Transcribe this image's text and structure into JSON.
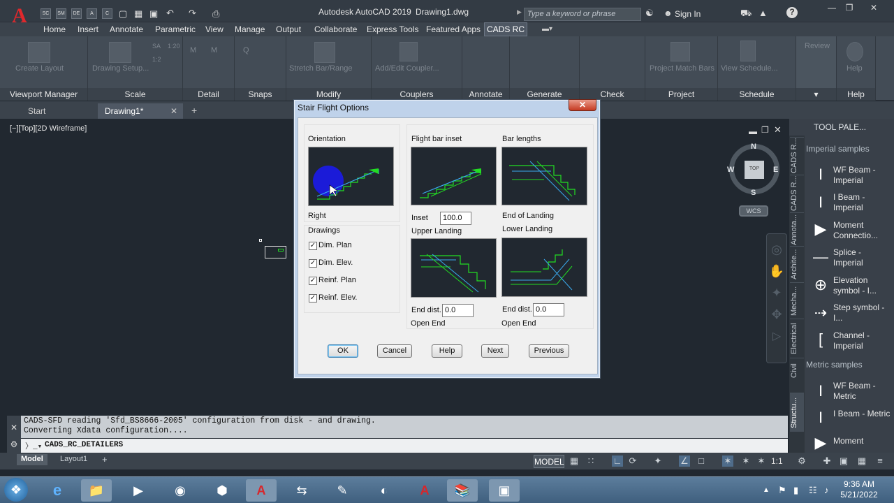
{
  "app": {
    "title": "Autodesk AutoCAD 2019",
    "file": "Drawing1.dwg",
    "logo": "A"
  },
  "quick_access": [
    "SC",
    "SM",
    "DE",
    "A",
    "C"
  ],
  "search": {
    "placeholder": "Type a keyword or phrase"
  },
  "signin": "Sign In",
  "ribbon_tabs": [
    "Home",
    "Insert",
    "Annotate",
    "Parametric",
    "View",
    "Manage",
    "Output",
    "Collaborate",
    "Express Tools",
    "Featured Apps"
  ],
  "ribbon_active_tab": "CADS RC",
  "ribbon": {
    "buttons": {
      "create_layout": "Create Layout",
      "drawing_setup": "Drawing Setup...",
      "stretch_bar": "Stretch Bar/Range",
      "add_coupler": "Add/Edit Coupler...",
      "project_match": "Project Match Bars",
      "view_schedule": "View Schedule...",
      "review": "Review",
      "help": "Help"
    },
    "groups": [
      "Viewport Manager",
      "Scale",
      "Detail",
      "Snaps",
      "Modify",
      "Couplers",
      "Annotate",
      "Generate",
      "Check",
      "Project",
      "Schedule",
      "",
      "Help"
    ],
    "small": {
      "sa": "SA",
      "scale120": "1:20",
      "scale12": "1:2",
      "m1": "M",
      "m2": "M",
      "q": "Q"
    }
  },
  "doc_tabs": {
    "start": "Start",
    "drawing": "Drawing1*",
    "add": "+"
  },
  "viewport": {
    "label": "[−][Top][2D Wireframe]"
  },
  "viewcube": {
    "n": "N",
    "s": "S",
    "e": "E",
    "w": "W",
    "top": "TOP",
    "wcs": "WCS"
  },
  "palette": {
    "title": "TOOL PALE...",
    "side_tabs": [
      "CADS R...",
      "CADS R...",
      "Annota...",
      "Archite...",
      "Mecha...",
      "Electrical",
      "Civil",
      "Structu..."
    ],
    "imperial_header": "Imperial samples",
    "metric_header": "Metric samples",
    "items": [
      {
        "label": "WF Beam - Imperial",
        "icon": "I"
      },
      {
        "label": "I Beam - Imperial",
        "icon": "I"
      },
      {
        "label": "Moment Connectio...",
        "icon": "▶"
      },
      {
        "label": "Splice - Imperial",
        "icon": "—"
      },
      {
        "label": "Elevation symbol - I...",
        "icon": "⊕"
      },
      {
        "label": "Step symbol - I...",
        "icon": "⇢"
      },
      {
        "label": "Channel - Imperial",
        "icon": "["
      },
      {
        "label": "WF Beam - Metric",
        "icon": "I"
      },
      {
        "label": "I Beam - Metric",
        "icon": "I"
      },
      {
        "label": "Moment",
        "icon": "▶"
      }
    ]
  },
  "command": {
    "history": [
      "CADS-SFD reading 'Sfd_BS8666-2005' configuration from disk - and drawing.",
      "Converting Xdata configuration...."
    ],
    "current": "CADS_RC_DETAILERS"
  },
  "layout_tabs": {
    "model": "Model",
    "layout1": "Layout1",
    "add": "+"
  },
  "status": {
    "model_btn": "MODEL",
    "scale": "1:1"
  },
  "clock": {
    "time": "9:36 AM",
    "date": "5/21/2022"
  },
  "dialog": {
    "title": "Stair Flight Options",
    "close": "✕",
    "orientation_label": "Orientation",
    "orientation_value": "Right",
    "drawings_label": "Drawings",
    "checkboxes": [
      {
        "label": "Dim. Plan",
        "checked": "✓"
      },
      {
        "label": "Dim. Elev.",
        "checked": "✓"
      },
      {
        "label": "Reinf. Plan",
        "checked": "✓"
      },
      {
        "label": "Reinf. Elev.",
        "checked": "✓"
      }
    ],
    "flight_bar_inset": "Flight bar inset",
    "bar_lengths": "Bar lengths",
    "inset_label": "Inset",
    "inset_value": "100.0",
    "end_of_landing": "End of Landing",
    "upper_landing": "Upper Landing",
    "lower_landing": "Lower Landing",
    "end_dist_label": "End dist.",
    "upper_end_dist": "0.0",
    "lower_end_dist": "0.0",
    "open_end": "Open End",
    "buttons": {
      "ok": "OK",
      "cancel": "Cancel",
      "help": "Help",
      "next": "Next",
      "previous": "Previous"
    }
  },
  "colors": {
    "canvas": "#212830",
    "accent_green": "#22dd22",
    "cursor_blue": "#1b1bd8"
  }
}
